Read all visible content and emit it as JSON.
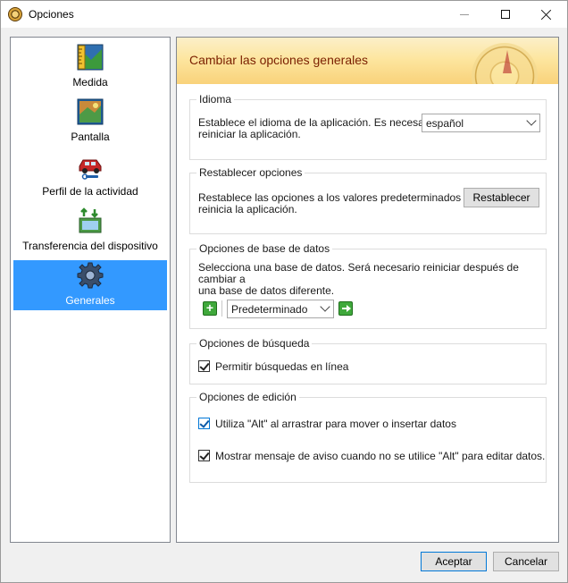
{
  "window": {
    "title": "Opciones",
    "app_icon": "compass-icon"
  },
  "sidebar": {
    "items": [
      {
        "label": "Medida",
        "icon": "ruler-map-icon",
        "selected": false
      },
      {
        "label": "Pantalla",
        "icon": "display-map-icon",
        "selected": false
      },
      {
        "label": "Perfil de la actividad",
        "icon": "car-wrench-icon",
        "selected": false
      },
      {
        "label": "Transferencia del dispositivo",
        "icon": "device-transfer-icon",
        "selected": false
      },
      {
        "label": "Generales",
        "icon": "gear-icon",
        "selected": true
      }
    ]
  },
  "banner": {
    "title": "Cambiar las opciones generales"
  },
  "idioma": {
    "title": "Idioma",
    "text": "Establece el idioma de la aplicación. Es necesario reiniciar la aplicación.",
    "line1": "Establece el idioma de la aplicación. Es necesario",
    "line2": "reiniciar la aplicación.",
    "selected_language": "español"
  },
  "restablecer": {
    "title": "Restablecer opciones",
    "line1": "Restablece las opciones a los valores predeterminados y",
    "line2": "reinicia la aplicación.",
    "button_label": "Restablecer"
  },
  "base_datos": {
    "title": "Opciones de base de datos",
    "line1": "Selecciona una base de datos.  Será necesario reiniciar después de cambiar a",
    "line2": "una base de datos diferente.",
    "selected_db": "Predeterminado"
  },
  "busqueda": {
    "title": "Opciones de búsqueda",
    "checkbox_label": "Permitir búsquedas en línea",
    "checked": true
  },
  "edicion": {
    "title": "Opciones de edición",
    "checkbox1_label": "Utiliza \"Alt\" al arrastrar para mover o insertar datos",
    "checkbox1_checked": true,
    "checkbox2_label": "Mostrar mensaje de aviso cuando no se utilice \"Alt\" para editar datos.",
    "checkbox2_checked": true
  },
  "footer": {
    "accept_label": "Aceptar",
    "cancel_label": "Cancelar"
  },
  "colors": {
    "selection": "#3399ff",
    "banner_text": "#7a1f00",
    "accent": "#0078d7"
  }
}
